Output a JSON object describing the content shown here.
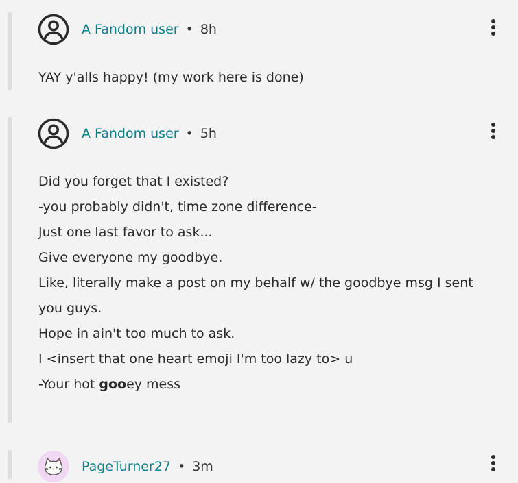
{
  "comments": [
    {
      "username": "A Fandom user",
      "separator": "•",
      "time": "8h",
      "lines": [
        "YAY y'alls happy! (my work here is done)"
      ]
    },
    {
      "username": "A Fandom user",
      "separator": "•",
      "time": "5h",
      "lines": [
        "Did you forget that I existed?",
        "-you probably didn't, time zone difference-",
        "Just one last favor to ask...",
        "Give everyone my goodbye.",
        "Like, literally make a post on my behalf w/ the goodbye msg I sent",
        "you guys.",
        "Hope in ain't too much to ask.",
        "I <insert that one heart emoji I'm too lazy to> u"
      ],
      "last_line": {
        "prefix": "-Your hot ",
        "bold": "goo",
        "suffix": "ey mess"
      }
    },
    {
      "username": "PageTurner27",
      "separator": "•",
      "time": "3m"
    }
  ],
  "icons": {
    "default_avatar": "user-circle-icon",
    "cat_avatar": "cat-avatar-icon",
    "more_options": "kebab-menu-icon"
  },
  "colors": {
    "username": "#0a7f8a",
    "background": "#f3f3f3",
    "thread_bar": "#dedede",
    "cat_avatar_bg": "#f0d7f2"
  }
}
